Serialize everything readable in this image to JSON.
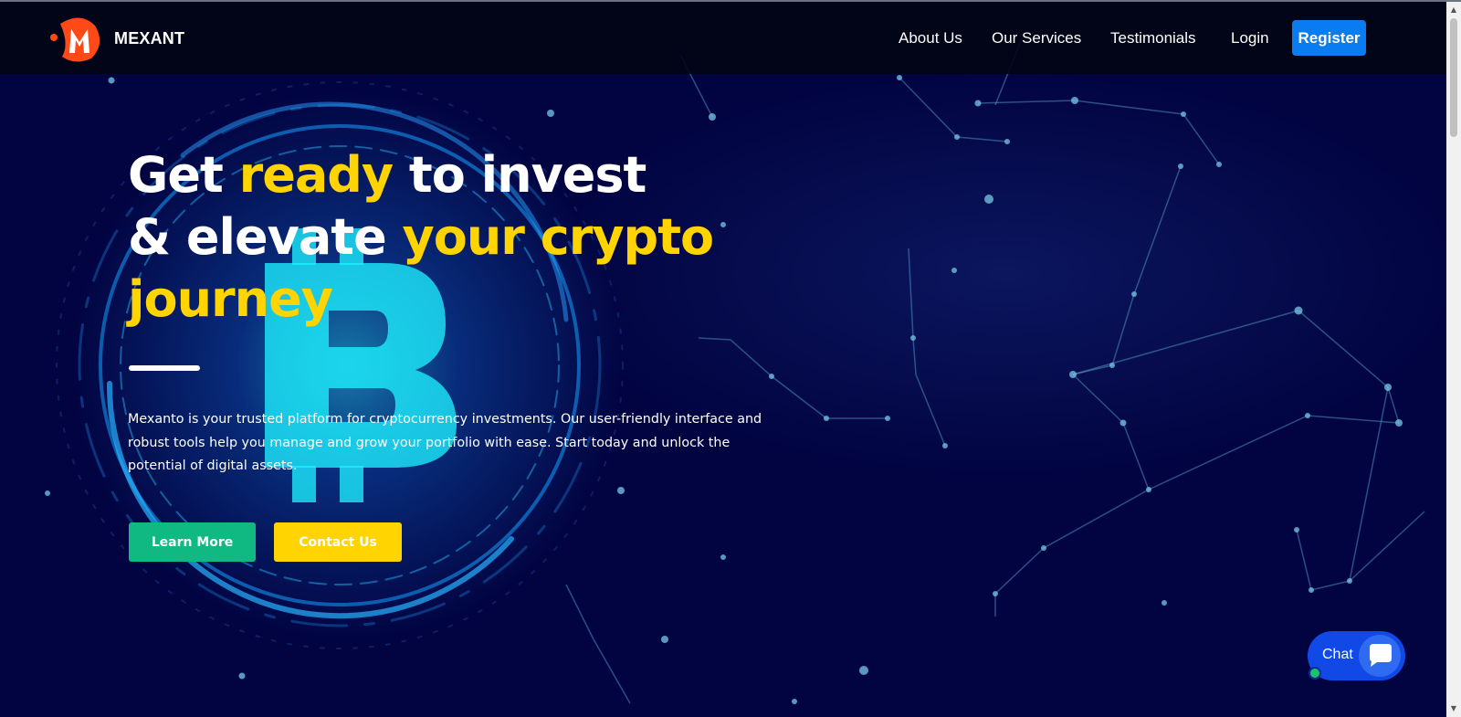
{
  "nav": {
    "brand": "MEXANT",
    "links": [
      "About Us",
      "Our Services",
      "Testimonials",
      "Login"
    ],
    "register_label": "Register"
  },
  "hero": {
    "headline": {
      "l1_a": "Get ",
      "l1_b": "ready",
      "l1_c": " to invest",
      "l2_a": "& elevate ",
      "l2_b": "your crypto",
      "l3": "journey"
    },
    "description": "Mexanto is your trusted platform for cryptocurrency investments. Our user-friendly interface and robust tools help you manage and grow your portfolio with ease. Start today and unlock the potential of digital assets.",
    "learn_more_label": "Learn More",
    "contact_label": "Contact Us"
  },
  "chat": {
    "label": "Chat"
  },
  "icons": {
    "logo": "mexant-logo-icon",
    "chat": "chat-bubble-icon",
    "bitcoin": "bitcoin-icon"
  },
  "colors": {
    "accent_yellow": "#ffd400",
    "accent_green": "#0fb981",
    "register_blue": "#0a7cf2",
    "chat_blue": "#1049e6",
    "background_navy": "#03063f"
  }
}
